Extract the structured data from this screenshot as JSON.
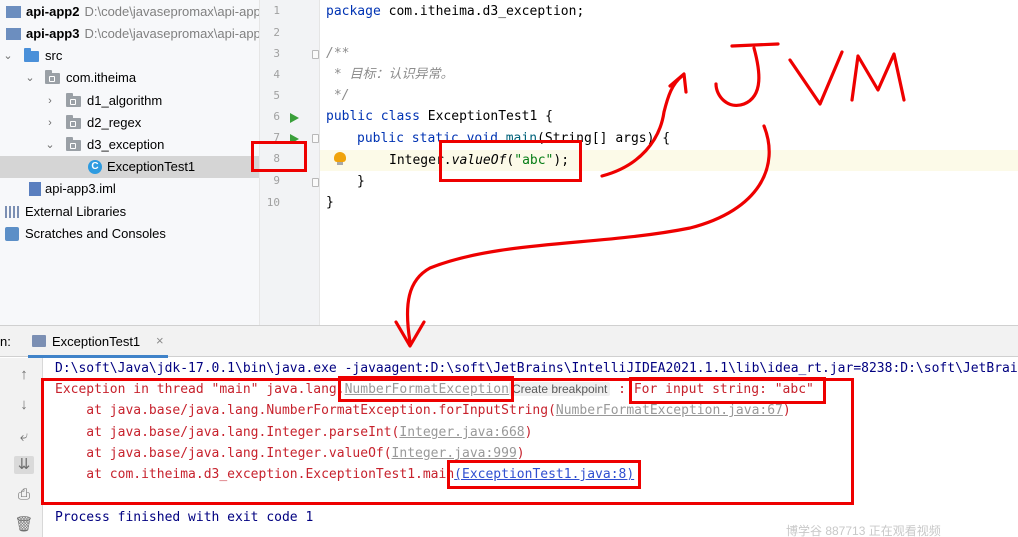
{
  "project_tree": {
    "items": [
      {
        "label": "api-app2",
        "path": "D:\\code\\javasepromax\\api-app"
      },
      {
        "label": "api-app3",
        "path": "D:\\code\\javasepromax\\api-app"
      },
      {
        "label": "src"
      },
      {
        "label": "com.itheima"
      },
      {
        "label": "d1_algorithm"
      },
      {
        "label": "d2_regex"
      },
      {
        "label": "d3_exception"
      },
      {
        "label": "ExceptionTest1"
      },
      {
        "label": "api-app3.iml"
      },
      {
        "label": "External Libraries"
      },
      {
        "label": "Scratches and Consoles"
      }
    ]
  },
  "editor": {
    "line_numbers": [
      "1",
      "2",
      "3",
      "4",
      "5",
      "6",
      "7",
      "8",
      "9",
      "10"
    ],
    "code": {
      "l1_kw": "package",
      "l1_rest": " com.itheima.d3_exception;",
      "l3": "/**",
      "l4_star": " * ",
      "l4_text": "目标：认识异常。",
      "l5": " */",
      "l6_kw1": "public",
      "l6_kw2": "class",
      "l6_rest": " ExceptionTest1 {",
      "l7_kw1": "public",
      "l7_kw2": "static",
      "l7_kw3": "void",
      "l7_fn": "main",
      "l7_rest": "(String[] args) {",
      "l8_a": "Integer.",
      "l8_fn": "valueOf",
      "l8_p1": "(",
      "l8_str": "\"abc\"",
      "l8_p2": ");",
      "l9": "}",
      "l10": "}"
    }
  },
  "run_panel": {
    "label": "n:",
    "tab_label": "ExceptionTest1",
    "tab_close": "×",
    "toolbar_icons": [
      "arrow-up-icon",
      "arrow-down-icon",
      "soft-wrap-icon",
      "scroll-to-end-icon",
      "print-icon",
      "trash-icon"
    ],
    "console": {
      "cmd": "D:\\soft\\Java\\jdk-17.0.1\\bin\\java.exe -javaagent:D:\\soft\\JetBrains\\IntelliJIDEA2021.1.1\\lib\\idea_rt.jar=8238:D:\\soft\\JetBrai",
      "ex_prefix": "Exception in thread \"main\" java.lang.",
      "ex_class": "NumberFormatException",
      "ex_breakpoint": "Create breakpoint",
      "ex_suffix": " : For input string: \"abc\"",
      "st1_prefix": "    at java.base/java.lang.NumberFormatException.forInputString(",
      "st1_link": "NumberFormatException.java:67",
      "st1_suffix": ")",
      "st2_prefix": "    at java.base/java.lang.Integer.parseInt(",
      "st2_link": "Integer.java:668",
      "st2_suffix": ")",
      "st3_prefix": "    at java.base/java.lang.Integer.valueOf(",
      "st3_link": "Integer.java:999",
      "st3_suffix": ")",
      "st4_prefix": "    at com.itheima.d3_exception.ExceptionTest1.main",
      "st4_link": "(ExceptionTest1.java:8)",
      "st4_suffix": "",
      "finish": "Process finished with exit code 1"
    }
  },
  "watermark": "博学谷 887713 正在观看视频",
  "annotation": {
    "handwritten_text": "JVM",
    "color": "#ee0000"
  }
}
